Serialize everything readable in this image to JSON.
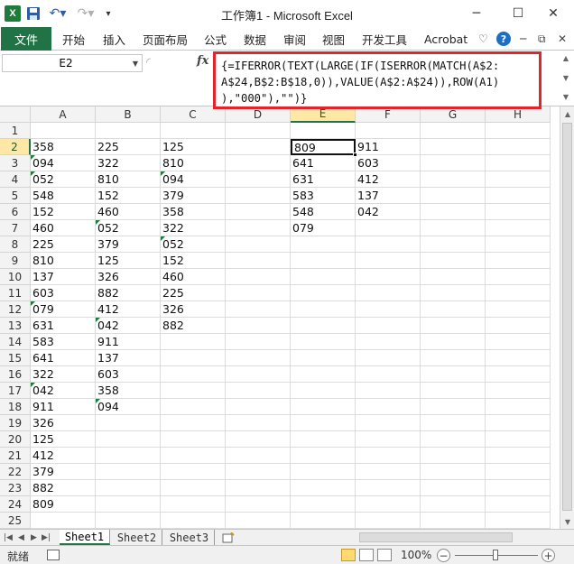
{
  "window": {
    "title": "工作簿1 - Microsoft Excel",
    "minimize_glyph": "─",
    "maximize_glyph": "☐",
    "close_glyph": "✕",
    "help_glyph": "?"
  },
  "quick_access": {
    "app_icon_text": "X",
    "save_icon": "floppy-disk",
    "undo_glyph": "↶▾",
    "redo_glyph": "↷▾",
    "customize_glyph": "▾"
  },
  "ribbon": {
    "file_tab": "文件",
    "tabs": [
      "开始",
      "插入",
      "页面布局",
      "公式",
      "数据",
      "审阅",
      "视图",
      "开发工具",
      "Acrobat"
    ],
    "right_icons": {
      "collapse_glyph": "♡",
      "help_glyph": "?",
      "min_glyph": "─",
      "restore_glyph": "⧉",
      "close_glyph": "✕"
    },
    "accent_color": "#217346"
  },
  "formula_bar": {
    "name_box": "E2",
    "fx_label": "fx",
    "formula_lines": [
      "{=IFERROR(TEXT(LARGE(IF(ISERROR(MATCH(A$2:",
      "A$24,B$2:B$18,0)),VALUE(A$2:A$24)),ROW(A1)",
      "),\"000\"),\"\")}"
    ],
    "highlight_color": "#e3242b"
  },
  "sheet": {
    "columns": [
      "A",
      "B",
      "C",
      "D",
      "E",
      "F",
      "G",
      "H"
    ],
    "selected_column": "E",
    "selected_row": 2,
    "active_cell": "E2",
    "rows": [
      {
        "n": 1,
        "cells": {}
      },
      {
        "n": 2,
        "cells": {
          "A": "358",
          "B": "225",
          "C": "125",
          "E": "809",
          "F": "911"
        }
      },
      {
        "n": 3,
        "cells": {
          "A": "094",
          "B": "322",
          "C": "810",
          "E": "641",
          "F": "603"
        }
      },
      {
        "n": 4,
        "cells": {
          "A": "052",
          "B": "810",
          "C": "094",
          "E": "631",
          "F": "412"
        }
      },
      {
        "n": 5,
        "cells": {
          "A": "548",
          "B": "152",
          "C": "379",
          "E": "583",
          "F": "137"
        }
      },
      {
        "n": 6,
        "cells": {
          "A": "152",
          "B": "460",
          "C": "358",
          "E": "548",
          "F": "042"
        }
      },
      {
        "n": 7,
        "cells": {
          "A": "460",
          "B": "052",
          "C": "322",
          "E": "079"
        }
      },
      {
        "n": 8,
        "cells": {
          "A": "225",
          "B": "379",
          "C": "052"
        }
      },
      {
        "n": 9,
        "cells": {
          "A": "810",
          "B": "125",
          "C": "152"
        }
      },
      {
        "n": 10,
        "cells": {
          "A": "137",
          "B": "326",
          "C": "460"
        }
      },
      {
        "n": 11,
        "cells": {
          "A": "603",
          "B": "882",
          "C": "225"
        }
      },
      {
        "n": 12,
        "cells": {
          "A": "079",
          "B": "412",
          "C": "326"
        }
      },
      {
        "n": 13,
        "cells": {
          "A": "631",
          "B": "042",
          "C": "882"
        }
      },
      {
        "n": 14,
        "cells": {
          "A": "583",
          "B": "911"
        }
      },
      {
        "n": 15,
        "cells": {
          "A": "641",
          "B": "137"
        }
      },
      {
        "n": 16,
        "cells": {
          "A": "322",
          "B": "603"
        }
      },
      {
        "n": 17,
        "cells": {
          "A": "042",
          "B": "358"
        }
      },
      {
        "n": 18,
        "cells": {
          "A": "911",
          "B": "094"
        }
      },
      {
        "n": 19,
        "cells": {
          "A": "326"
        }
      },
      {
        "n": 20,
        "cells": {
          "A": "125"
        }
      },
      {
        "n": 21,
        "cells": {
          "A": "412"
        }
      },
      {
        "n": 22,
        "cells": {
          "A": "379"
        }
      },
      {
        "n": 23,
        "cells": {
          "A": "882"
        }
      },
      {
        "n": 24,
        "cells": {
          "A": "809"
        }
      },
      {
        "n": 25,
        "cells": {}
      }
    ],
    "text_marked_cells": [
      "A3",
      "A4",
      "A12",
      "A17",
      "B7",
      "B13",
      "B18",
      "C4",
      "C8"
    ]
  },
  "sheet_tabs": {
    "nav_glyphs": [
      "|◀",
      "◀",
      "▶",
      "▶|"
    ],
    "tabs": [
      "Sheet1",
      "Sheet2",
      "Sheet3"
    ],
    "active": "Sheet1",
    "new_sheet_icon": "insert-sheet"
  },
  "status_bar": {
    "status": "就绪",
    "zoom": "100%",
    "zoom_out": "−",
    "zoom_in": "+"
  }
}
